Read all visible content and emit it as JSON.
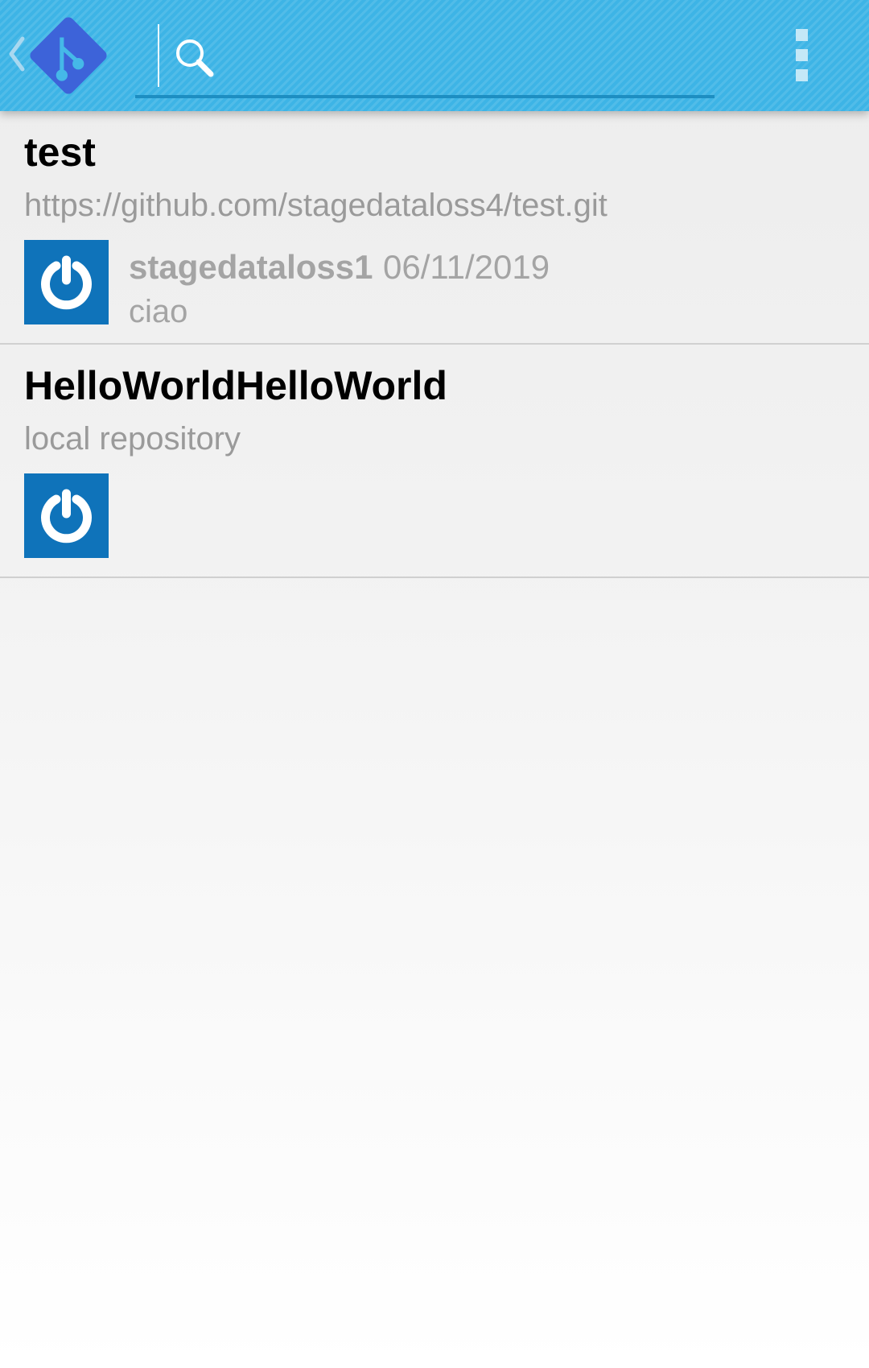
{
  "theme": {
    "action_bar_color": "#3db4e6",
    "logo_color": "#3d63d9",
    "avatar_color": "#0f73ba"
  },
  "action_bar": {
    "up_icon": "chevron-left-icon",
    "logo_icon": "git-logo-icon",
    "search_icon": "search-icon",
    "search_value": "",
    "overflow_icon": "overflow-menu-icon"
  },
  "repositories": [
    {
      "name": "test",
      "remote": "https://github.com/stagedataloss4/test.git",
      "avatar_icon": "power-avatar-icon",
      "commit": {
        "author": "stagedataloss1",
        "date": "06/11/2019",
        "message": "ciao"
      }
    },
    {
      "name": "HelloWorldHelloWorld",
      "remote": "local repository",
      "avatar_icon": "power-avatar-icon"
    }
  ]
}
